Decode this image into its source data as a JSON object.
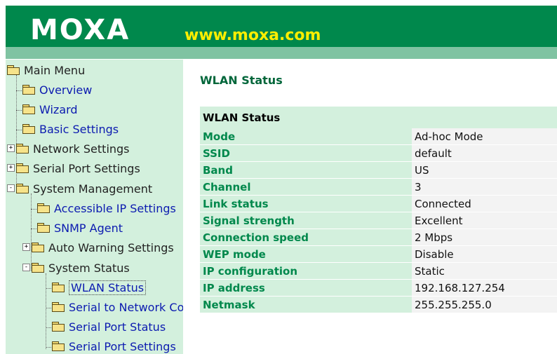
{
  "header": {
    "logo_text": "MOXA",
    "site_url": "www.moxa.com",
    "colors": {
      "banner": "#00884c",
      "banner_strip": "#7fc3a2",
      "url": "#ffee00"
    }
  },
  "sidebar": {
    "root_label": "Main Menu",
    "items": [
      {
        "label": "Overview",
        "icon": "folder-icon"
      },
      {
        "label": "Wizard",
        "icon": "folder-icon"
      },
      {
        "label": "Basic Settings",
        "icon": "folder-icon"
      },
      {
        "label": "Network Settings",
        "icon": "folder-icon",
        "expander": "+"
      },
      {
        "label": "Serial Port Settings",
        "icon": "folder-icon",
        "expander": "+"
      },
      {
        "label": "System Management",
        "icon": "folder-open-icon",
        "expander": "-"
      },
      {
        "label": "Accessible IP Settings",
        "icon": "folder-icon"
      },
      {
        "label": "SNMP Agent",
        "icon": "folder-icon"
      },
      {
        "label": "Auto Warning Settings",
        "icon": "folder-icon",
        "expander": "+"
      },
      {
        "label": "System Status",
        "icon": "folder-open-icon",
        "expander": "-"
      },
      {
        "label": "WLAN Status",
        "icon": "folder-icon",
        "selected": true
      },
      {
        "label": "Serial to Network Co",
        "icon": "folder-icon"
      },
      {
        "label": "Serial Port Status",
        "icon": "folder-icon"
      },
      {
        "label": "Serial Port Settings",
        "icon": "folder-icon"
      }
    ]
  },
  "main": {
    "page_title": "WLAN Status",
    "table_heading": "WLAN Status",
    "rows": [
      {
        "label": "Mode",
        "value": "Ad-hoc Mode"
      },
      {
        "label": "SSID",
        "value": "default"
      },
      {
        "label": "Band",
        "value": "US"
      },
      {
        "label": "Channel",
        "value": "3"
      },
      {
        "label": "Link status",
        "value": "Connected"
      },
      {
        "label": "Signal strength",
        "value": "Excellent"
      },
      {
        "label": "Connection speed",
        "value": "2 Mbps"
      },
      {
        "label": "WEP mode",
        "value": "Disable"
      },
      {
        "label": "IP configuration",
        "value": "Static"
      },
      {
        "label": "IP address",
        "value": "192.168.127.254"
      },
      {
        "label": "Netmask",
        "value": "255.255.255.0"
      }
    ]
  }
}
